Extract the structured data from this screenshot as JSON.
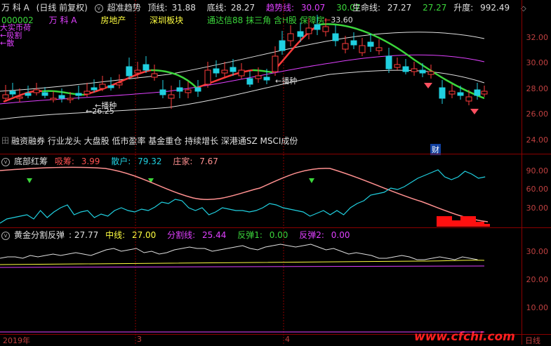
{
  "main": {
    "stock_name": "万 科 A",
    "period": "(日线 前复权)",
    "indicator_name": "超准趋势",
    "top_line_label": "顶线:",
    "top_line_value": "31.88",
    "bottom_line_label": "底线:",
    "bottom_line_value": "28.27",
    "trend_label": "趋势线:",
    "trend_value1": "30.07",
    "trend_value2": "30.07",
    "life_line_label": "生命线:",
    "life_value1": "27.27",
    "life_value2": "27.27",
    "rise_label": "升度:",
    "rise_value": "992.49",
    "code": "000002",
    "name2": "万 科 A",
    "industry": "房地产",
    "board": "深圳板块",
    "concept_line": "通达信88 抹三角 含H股 保障房",
    "left_tag1": "大实币荷",
    "left_tag2": "←吸割",
    "left_tag3": "←散",
    "price_high": "33.60",
    "price_low": "26.25",
    "marker_low": "←",
    "bo_zhong1": "←播种",
    "bo_zhong2": "←播种",
    "concepts_bottom": "融资融券 行业龙头 大盘股 低市盈率 基金重仓 持续增长 深港通SZ MSCI成份",
    "fin_badge": "财",
    "y_labels": [
      "32.00",
      "30.00",
      "28.00",
      "26.00",
      "24.00"
    ],
    "corner_text": "田"
  },
  "panel2": {
    "name": "底部红筹",
    "xichou_label": "吸筹:",
    "xichou_value": "3.99",
    "sanhu_label": "散户:",
    "sanhu_value": "79.32",
    "zhuangjia_label": "庄家:",
    "zhuangjia_value": "7.67",
    "y_labels": [
      "90.00",
      "60.00",
      "30.00"
    ]
  },
  "panel3": {
    "name": "黄金分割反弹",
    "value1": ": 27.77",
    "mid_label": "中线:",
    "mid_value": "27.00",
    "fen_label": "分割线:",
    "fen_value": "25.44",
    "fan1_label": "反弹1:",
    "fan1_value": "0.00",
    "fan2_label": "反弹2:",
    "fan2_value": "0.00",
    "y_labels": [
      "30.00",
      "20.00",
      "10.00"
    ]
  },
  "footer": {
    "year_label": "2019年",
    "month3": "3",
    "month4": "4",
    "watermark": "www.cfchi.com",
    "right_label": "日线"
  },
  "colors": {
    "red": "#ff3b3b",
    "green": "#3bd63b",
    "cyan": "#20d0e0",
    "magenta": "#e040ff",
    "yellow": "#ffff40",
    "pink": "#ff9090",
    "white": "#e0e0e0",
    "grid": "#8b0000"
  }
}
